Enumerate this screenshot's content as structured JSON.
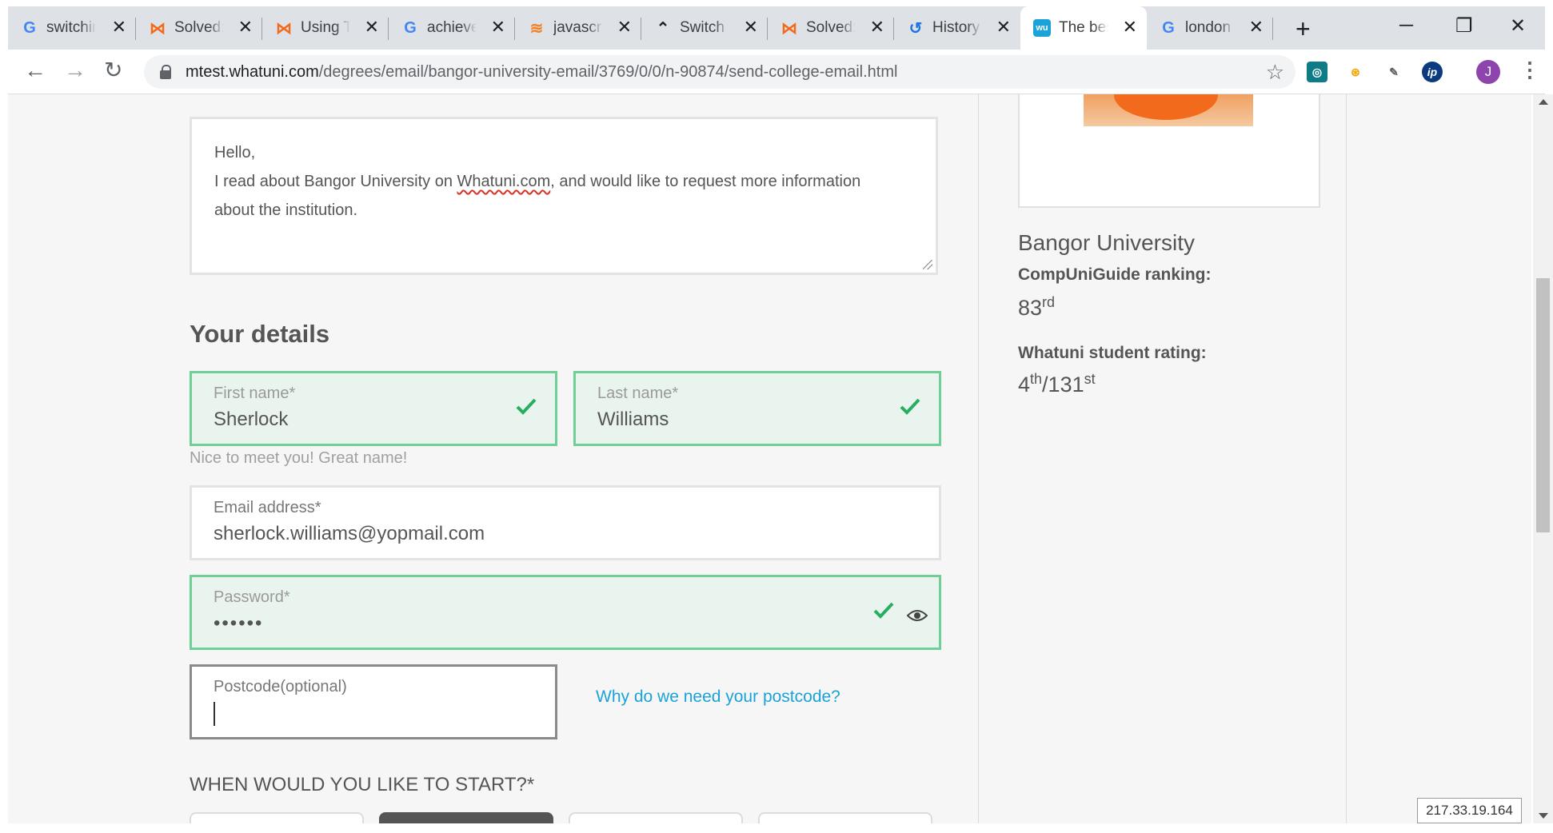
{
  "browser": {
    "tabs": [
      {
        "title": "switchin",
        "icon": "google-icon",
        "active": false
      },
      {
        "title": "Solved:",
        "icon": "community-icon",
        "active": false
      },
      {
        "title": "Using Th",
        "icon": "community-icon",
        "active": false
      },
      {
        "title": "achieve",
        "icon": "google-icon",
        "active": false
      },
      {
        "title": "javascrip",
        "icon": "stackoverflow-icon",
        "active": false
      },
      {
        "title": "Switch",
        "icon": "bird-icon",
        "active": false
      },
      {
        "title": "Solved:",
        "icon": "community-icon",
        "active": false
      },
      {
        "title": "History",
        "icon": "history-icon",
        "active": false
      },
      {
        "title": "The bes",
        "icon": "whatuni-icon",
        "active": true
      },
      {
        "title": "london",
        "icon": "google-icon",
        "active": false
      }
    ],
    "url_host": "mtest.whatuni.com",
    "url_path": "/degrees/email/bangor-university-email/3769/0/0/n-90874/send-college-email.html",
    "profile_initial": "J",
    "accent_color": "#8e44ad"
  },
  "message": {
    "line1": "Hello,",
    "line2_before": "I read about Bangor University on ",
    "line2_link": "Whatuni.com",
    "line2_after": ", and would like to request more information",
    "line3": "about the institution."
  },
  "details": {
    "heading": "Your details",
    "first_name_label": "First name*",
    "first_name_value": "Sherlock",
    "last_name_label": "Last name*",
    "last_name_value": "Williams",
    "helper": "Nice to meet you! Great name!",
    "email_label": "Email address*",
    "email_value": "sherlock.williams@yopmail.com",
    "password_label": "Password*",
    "password_value": "••••••",
    "postcode_label": "Postcode(optional)",
    "postcode_link": "Why do we need your postcode?",
    "start_heading": "WHEN WOULD YOU LIKE TO START?*",
    "valid_color": "#27ae60",
    "link_color": "#1ba3d8"
  },
  "sidebar": {
    "uni_name": "Bangor University",
    "ranking_label": "CompUniGuide ranking:",
    "ranking_value": "83",
    "ranking_suffix": "rd",
    "rating_label": "Whatuni student rating:",
    "rating_value": "4",
    "rating_suffix": "th",
    "rating_total": "/131",
    "rating_total_suffix": "st"
  },
  "ip_address": "217.33.19.164"
}
